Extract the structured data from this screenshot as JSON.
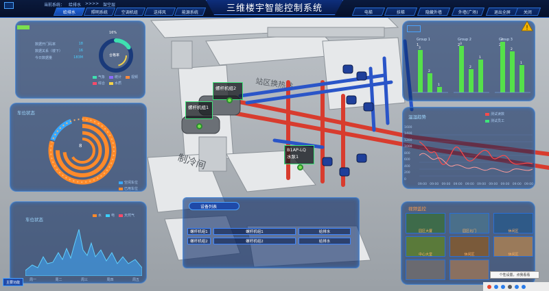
{
  "app": {
    "title": "三维楼宇智能控制系统",
    "breadcrumb_label": "当前系统：",
    "breadcrumb_current": "给排水",
    "breadcrumb_sep": ">>>>",
    "breadcrumb_floor": "架空层"
  },
  "nav_left": [
    {
      "label": "给排水",
      "active": true
    },
    {
      "label": "照明系统",
      "active": false
    },
    {
      "label": "空调机组",
      "active": false
    },
    {
      "label": "送排风",
      "active": false
    },
    {
      "label": "能源系统",
      "active": false
    }
  ],
  "nav_right": [
    {
      "label": "电梯"
    },
    {
      "label": "扶梯"
    },
    {
      "label": "隐藏外墙"
    },
    {
      "label": "外墙(广场)"
    },
    {
      "label": "退出全屏"
    },
    {
      "label": "关闭"
    }
  ],
  "panel_tl": {
    "rows": [
      {
        "label": "数据开门码率",
        "value": "18"
      },
      {
        "label": "数据关系（楼下）",
        "value": "16"
      },
      {
        "label": "今日数据量",
        "value": "183M"
      }
    ],
    "donut_label": "合格率",
    "donut_pct": "16%",
    "donut_value": 0.16,
    "legend": [
      {
        "label": "气象",
        "color": "#3fe0b0"
      },
      {
        "label": "统计",
        "color": "#8a6bff"
      },
      {
        "label": "视频",
        "color": "#ff8a3d"
      },
      {
        "label": "综合",
        "color": "#ff4a6a"
      },
      {
        "label": "水质",
        "color": "#f4d24a"
      }
    ]
  },
  "panel_ml": {
    "title": "车位状态",
    "center_value": "8",
    "legend": [
      {
        "label": "空闲车位",
        "color": "#38a8ff"
      },
      {
        "label": "已用车位",
        "color": "#ff8a2a"
      }
    ]
  },
  "panel_bl": {
    "title": "车位状态",
    "legend": [
      {
        "label": "水",
        "color": "#ff8a2a"
      },
      {
        "label": "电",
        "color": "#3ad0ff"
      },
      {
        "label": "天然气",
        "color": "#ff4a6a"
      }
    ],
    "x_labels": [
      "周一",
      "周二",
      "周三",
      "周四",
      "周五"
    ]
  },
  "panel_tr": {
    "groups": [
      "Group 1",
      "Group 2",
      "Group 3"
    ],
    "top_values": [
      "1",
      "2",
      "2"
    ],
    "bar_labels": [
      "3",
      "2",
      "1"
    ]
  },
  "panel_mr": {
    "title": "温湿趋势",
    "legend": [
      {
        "label": "测试读数",
        "color": "#ff4a4a"
      },
      {
        "label": "测试员工",
        "color": "#3ee57a"
      }
    ],
    "y_ticks": [
      "1600",
      "1400",
      "1200",
      "1000",
      "800",
      "600",
      "400",
      "200",
      "0"
    ],
    "x_ticks": [
      "09:00",
      "09:00",
      "09:00",
      "09:00",
      "09:00",
      "09:00",
      "09:00",
      "09:00",
      "09:00",
      "09:00"
    ]
  },
  "panel_br": {
    "title": "视频监控",
    "cams": [
      {
        "label": "园区大厦"
      },
      {
        "label": "园区北门"
      },
      {
        "label": "休闲区"
      },
      {
        "label": "中心大堂"
      },
      {
        "label": "休闲区"
      },
      {
        "label": "休闲区"
      },
      {
        "label": ""
      },
      {
        "label": ""
      }
    ]
  },
  "device_list": {
    "title": "设备列表",
    "rows": [
      {
        "c1": "螺杆机组1",
        "c2": "螺杆机组1",
        "c3": "给排水"
      },
      {
        "c1": "螺杆机组2",
        "c2": "螺杆机组2",
        "c3": "给排水"
      }
    ]
  },
  "scene_labels": {
    "machine1": "螺杆机组1",
    "machine2": "螺杆机组2",
    "room1": "站区换热站",
    "room2": "制冷间",
    "pump_a": "B1AP-LQ",
    "pump_b": "水泵1"
  },
  "bottom_button": "主要功能",
  "tooltip": "个性设置，点我看看",
  "colors": {
    "accent": "#1d62d8",
    "panel_border": "#3f86ff",
    "pipe_red": "#d83c2e",
    "pipe_blue": "#2a55c8"
  }
}
